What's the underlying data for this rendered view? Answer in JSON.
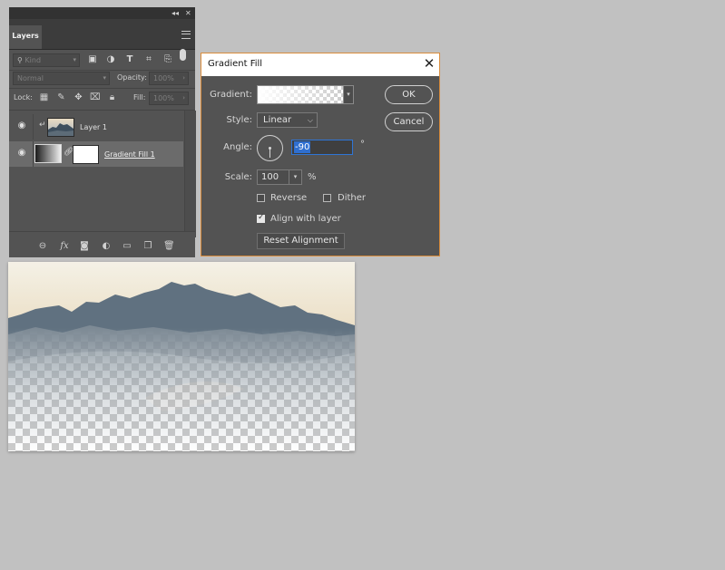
{
  "layers_panel": {
    "topbar": {
      "collapse_glyph": "◂◂",
      "close_glyph": "✕"
    },
    "tab_label": "Layers",
    "filter": {
      "value": "Kind",
      "icons": [
        "image-filter-icon",
        "adjustment-filter-icon",
        "type-filter-icon",
        "shape-filter-icon",
        "smart-object-filter-icon",
        "filter-toggle-icon"
      ]
    },
    "blend_mode": "Normal",
    "opacity": {
      "label": "Opacity:",
      "value": "100%"
    },
    "lock": {
      "label": "Lock:",
      "icons": [
        "lock-transparent-pixels-icon",
        "lock-image-pixels-icon",
        "lock-position-icon",
        "lock-artboard-icon",
        "lock-all-icon"
      ]
    },
    "fill": {
      "label": "Fill:",
      "value": "100%"
    },
    "layers": [
      {
        "name": "Layer 1",
        "clipped": true,
        "visible": true,
        "selected": false
      },
      {
        "name": "Gradient Fill 1",
        "clipped": false,
        "visible": true,
        "selected": true
      }
    ],
    "footer_icons": [
      "link-layers-icon",
      "fx-icon",
      "add-mask-icon",
      "new-adjustment-layer-icon",
      "new-group-icon",
      "new-layer-icon",
      "delete-layer-icon"
    ],
    "footer_fx_label": "fx"
  },
  "dialog": {
    "title": "Gradient Fill",
    "close_glyph": "✕",
    "gradient_label": "Gradient:",
    "style_label": "Style:",
    "style_value": "Linear",
    "angle_label": "Angle:",
    "angle_value": "-90",
    "angle_unit": "°",
    "scale_label": "Scale:",
    "scale_value": "100",
    "scale_unit": "%",
    "reverse_label": "Reverse",
    "reverse_checked": false,
    "dither_label": "Dither",
    "dither_checked": false,
    "align_label": "Align with layer",
    "align_checked": true,
    "reset_label": "Reset Alignment",
    "ok_label": "OK",
    "cancel_label": "Cancel"
  },
  "colors": {
    "app_background": "#c1c1c1",
    "panel_bg": "#535353",
    "dialog_border_accent": "#d98c3c",
    "selection_blue": "#2f6fd0"
  }
}
